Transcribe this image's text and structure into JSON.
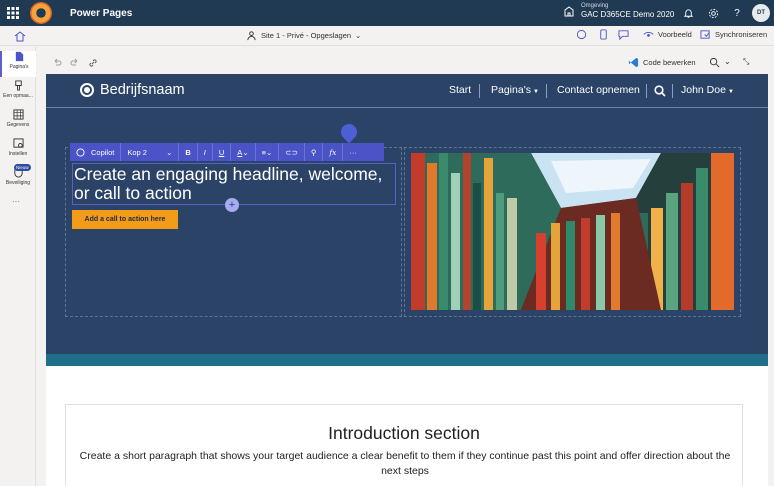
{
  "app": {
    "title": "Power Pages"
  },
  "environment": {
    "label": "Omgeving",
    "name": "GAC D365CE Demo 2020"
  },
  "user": {
    "initials": "DT"
  },
  "icons": [
    "waffle-icon",
    "bell-icon",
    "gear-icon",
    "help-icon",
    "home-icon",
    "page-icon",
    "style-icon",
    "table-icon",
    "settings-icon",
    "shield-icon",
    "undo-icon",
    "redo-icon",
    "link-icon",
    "search-icon",
    "vscode-icon",
    "zoom-icon",
    "collapse-icon"
  ],
  "toolbar": {
    "site_status": "Site 1 - Privé - Opgeslagen",
    "preview": "Voorbeeld",
    "sync": "Synchroniseren",
    "code_edit": "Code bewerken"
  },
  "rail": {
    "items": [
      {
        "label": "Pagina's"
      },
      {
        "label": "Een opmaa..."
      },
      {
        "label": "Gegevens"
      },
      {
        "label": "Instellen"
      },
      {
        "label": "Beveiliging"
      }
    ],
    "new_badge": "Nieuw"
  },
  "site": {
    "brand": "Bedrijfsnaam",
    "nav": [
      "Start",
      "Pagina's",
      "Contact opnemen",
      "John Doe"
    ],
    "headline": "Create an engaging headline, welcome, or call to action",
    "cta": "Add a call to action here"
  },
  "editor": {
    "copilot": "Copilot",
    "style": "Kop 2",
    "bold": "B",
    "italic": "I",
    "underline": "U",
    "font_color": "A",
    "formula": "fx",
    "more": "···"
  },
  "intro": {
    "title": "Introduction section",
    "text": "Create a short paragraph that shows your target audience a clear benefit to them if they continue past this point and offer direction about the next steps"
  },
  "colors": {
    "topbar": "#1f3a52",
    "hero": "#2c4368",
    "accent": "#4b54c6",
    "cta": "#f39c1a",
    "band": "#1f6f8b"
  }
}
